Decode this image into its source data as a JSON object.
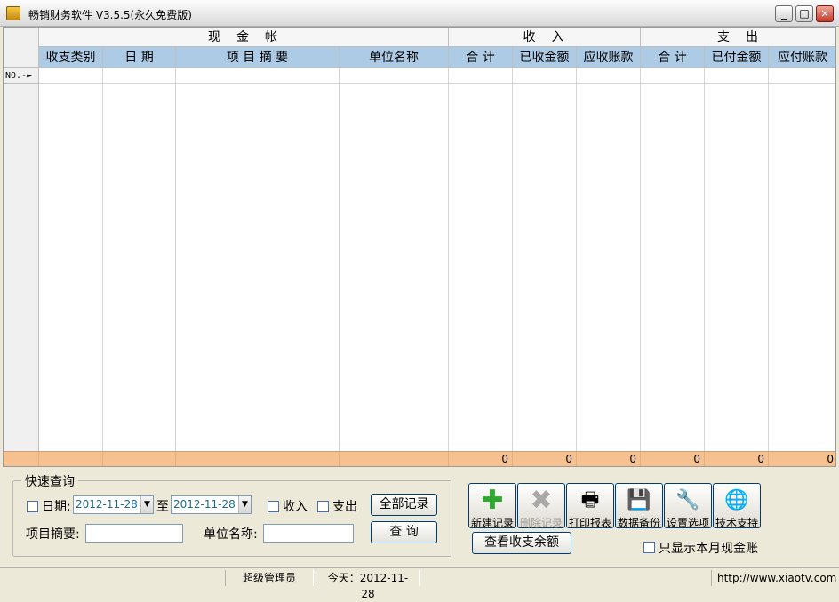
{
  "window": {
    "title": "畅销财务软件 V3.5.5(永久免费版)",
    "minimize": "_",
    "maximize": "□",
    "close": "×"
  },
  "grid": {
    "group_headers": [
      "现　金　帐",
      "收　入",
      "支　出"
    ],
    "columns": [
      "收支类别",
      "日 期",
      "项 目 摘 要",
      "单位名称",
      "合 计",
      "已收金额",
      "应收账款",
      "合 计",
      "已付金额",
      "应付账款"
    ],
    "row_label": "NO.-►",
    "totals": [
      "0",
      "0",
      "0",
      "0",
      "0",
      "0"
    ]
  },
  "quick_query": {
    "legend": "快速查询",
    "date_label": "日期:",
    "date_from": "2012-11-28",
    "to_label": "至",
    "date_to": "2012-11-28",
    "income_label": "收入",
    "expense_label": "支出",
    "all_records_button": "全部记录",
    "summary_label": "项目摘要:",
    "unit_label": "单位名称:",
    "query_button": "查 询"
  },
  "toolbar": {
    "new_record": "新建记录",
    "delete_record": "删除记录",
    "print_report": "打印报表",
    "backup": "数据备份",
    "settings": "设置选项",
    "support": "技术支持",
    "balance_button": "查看收支余额",
    "month_only_label": "只显示本月现金账"
  },
  "status": {
    "user": "超级管理员",
    "today": "今天：2012-11-28",
    "url": "http://www.xiaotv.com"
  }
}
